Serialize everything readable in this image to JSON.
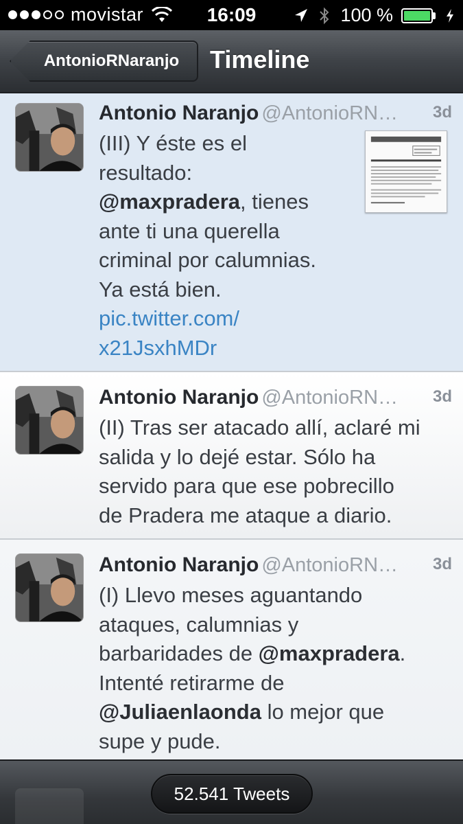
{
  "status_bar": {
    "carrier": "movistar",
    "time": "16:09",
    "battery_percent": "100 %",
    "battery_color": "#4cd964"
  },
  "nav": {
    "back_label": "AntonioRNaranjo",
    "title": "Timeline"
  },
  "tweets": [
    {
      "name": "Antonio Naranjo",
      "handle": "@AntonioRN…",
      "time": "3d",
      "lines": [
        {
          "parts": [
            {
              "text": "(III) Y éste es el"
            }
          ]
        },
        {
          "parts": [
            {
              "text": "resultado:"
            }
          ]
        },
        {
          "parts": [
            {
              "text": "@maxpradera",
              "kind": "mention"
            },
            {
              "text": ", tienes"
            }
          ]
        },
        {
          "parts": [
            {
              "text": "ante ti una querella"
            }
          ]
        },
        {
          "parts": [
            {
              "text": "criminal por calumnias."
            }
          ]
        },
        {
          "parts": [
            {
              "text": "Ya está bien."
            }
          ]
        },
        {
          "parts": [
            {
              "text": "pic.twitter.com/",
              "kind": "link"
            }
          ]
        },
        {
          "parts": [
            {
              "text": "x21JsxhMDr",
              "kind": "link"
            }
          ]
        }
      ]
    },
    {
      "name": "Antonio Naranjo",
      "handle": "@AntonioRN…",
      "time": "3d",
      "lines": [
        {
          "parts": [
            {
              "text": "(II) Tras ser atacado allí, aclaré mi"
            }
          ]
        },
        {
          "parts": [
            {
              "text": "salida y lo dejé estar. Sólo ha"
            }
          ]
        },
        {
          "parts": [
            {
              "text": "servido para que ese pobrecillo"
            }
          ]
        },
        {
          "parts": [
            {
              "text": "de Pradera me ataque a diario."
            }
          ]
        }
      ]
    },
    {
      "name": "Antonio Naranjo",
      "handle": "@AntonioRN…",
      "time": "3d",
      "lines": [
        {
          "parts": [
            {
              "text": "(I) Llevo meses aguantando"
            }
          ]
        },
        {
          "parts": [
            {
              "text": "ataques, calumnias y"
            }
          ]
        },
        {
          "parts": [
            {
              "text": "barbaridades de "
            },
            {
              "text": "@maxpradera",
              "kind": "mention"
            },
            {
              "text": "."
            }
          ]
        },
        {
          "parts": [
            {
              "text": "Intenté retirarme de"
            }
          ]
        },
        {
          "parts": [
            {
              "text": "@Juliaenlaonda",
              "kind": "mention"
            },
            {
              "text": " lo mejor que"
            }
          ]
        },
        {
          "parts": [
            {
              "text": "supe y pude."
            }
          ]
        }
      ]
    }
  ],
  "bottom": {
    "tweet_count": "52.541 Tweets"
  }
}
